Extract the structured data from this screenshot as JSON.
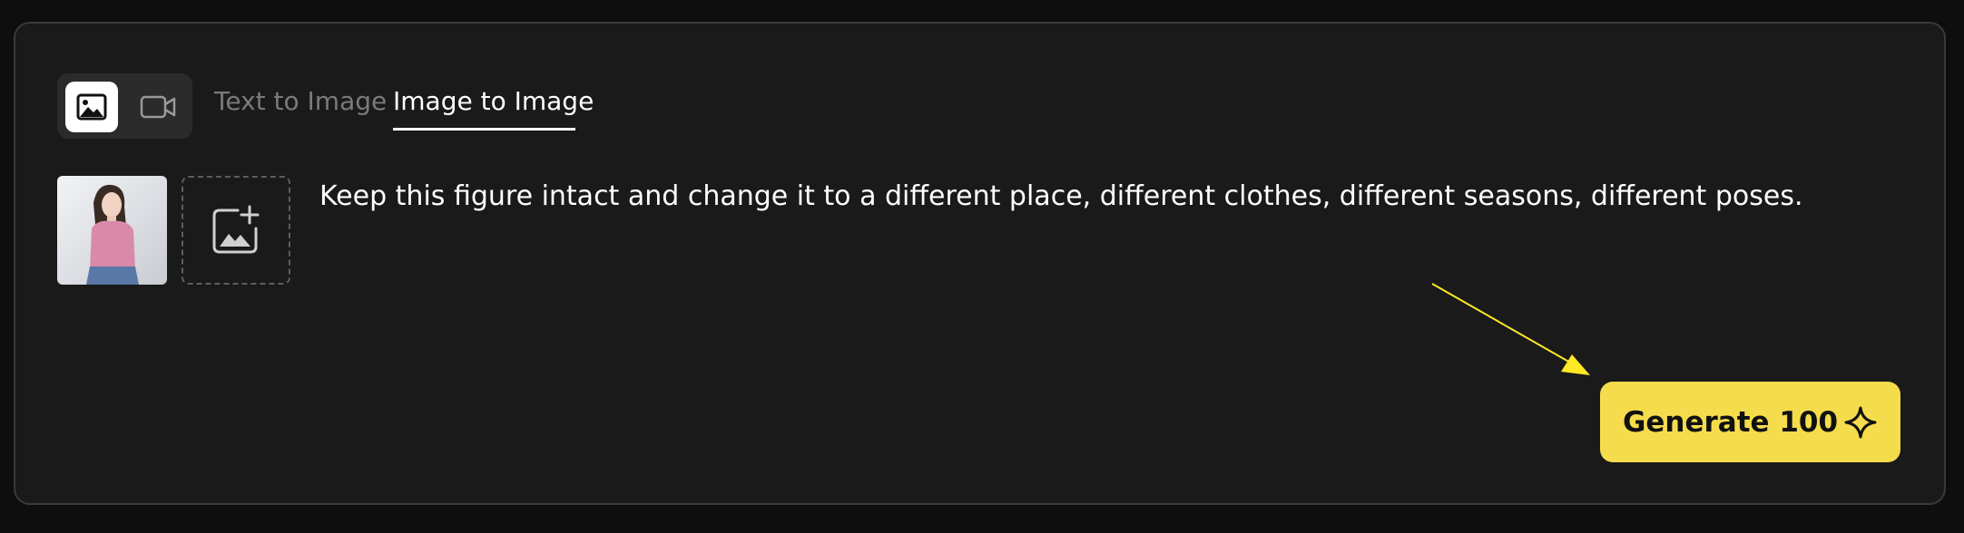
{
  "tabs": {
    "text_to_image": "Text to Image",
    "image_to_image": "Image to Image",
    "active": "image_to_image"
  },
  "mode_toggle": {
    "image_icon": "image-icon",
    "video_icon": "video-camera-icon",
    "active": "image"
  },
  "prompt": {
    "text": "Keep this figure intact and change it to a different place, different clothes, different seasons, different poses."
  },
  "generate_button": {
    "label": "Generate 100",
    "icon": "sparkle-icon"
  },
  "colors": {
    "accent": "#f5dc4c",
    "panel_bg": "#1a1a1a",
    "page_bg": "#0e0e0e",
    "arrow": "#ffe826"
  }
}
